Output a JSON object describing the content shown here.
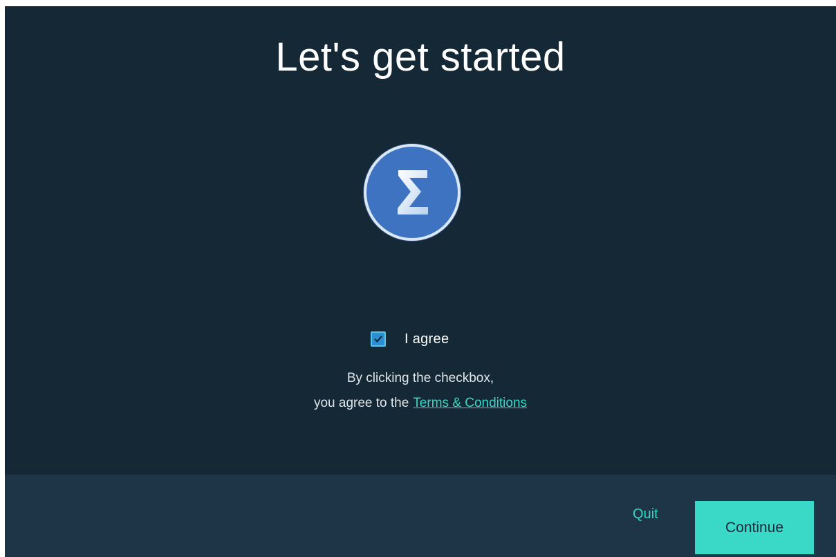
{
  "header": {
    "title": "Let's get started"
  },
  "logo": {
    "icon": "sigma-icon",
    "glyph": "Σ"
  },
  "agreement": {
    "checked": true,
    "checkbox_label": "I agree",
    "description_line1": "By clicking the checkbox,",
    "description_line2": "you agree to the",
    "terms_link": "Terms & Conditions"
  },
  "footer": {
    "quit_label": "Quit",
    "continue_label": "Continue"
  },
  "colors": {
    "background": "#152835",
    "footer": "#1e3548",
    "accent": "#3ad6c4",
    "logo_blue": "#3d73c0"
  }
}
